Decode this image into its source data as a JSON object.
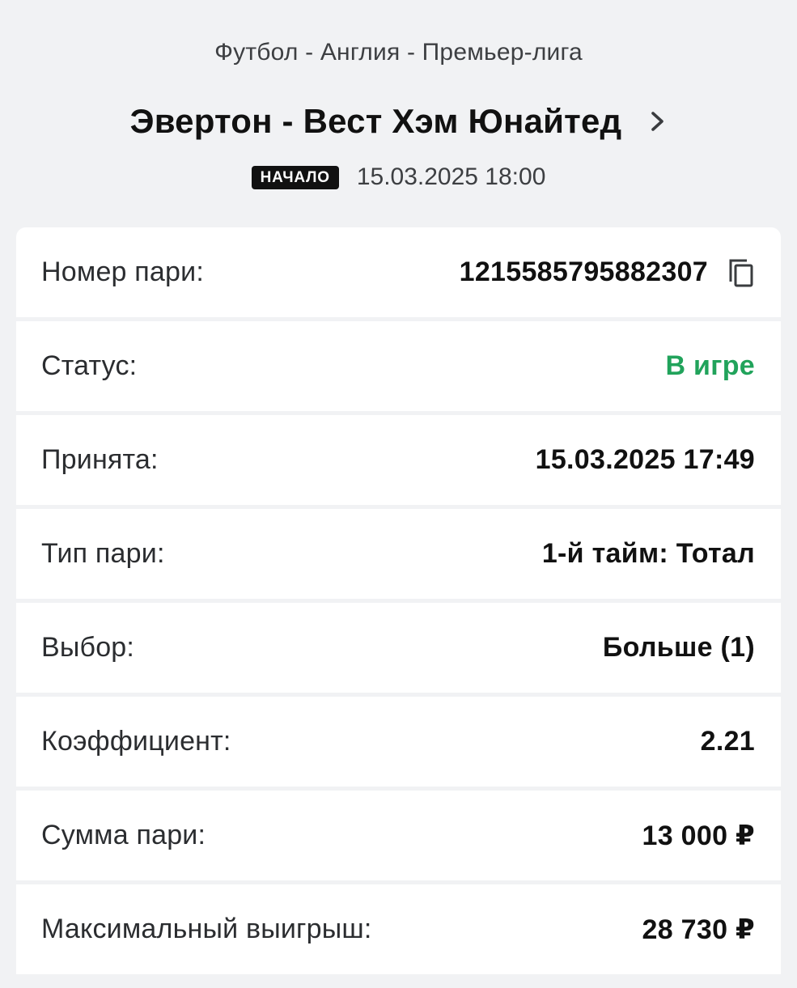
{
  "event": {
    "league": "Футбол - Англия - Премьер-лига",
    "match_title": "Эвертон - Вест Хэм Юнайтед",
    "start_badge": "НАЧАЛО",
    "start_datetime": "15.03.2025 18:00"
  },
  "details": [
    {
      "label": "Номер пари:",
      "value": "1215585795882307"
    },
    {
      "label": "Статус:",
      "value": "В игре"
    },
    {
      "label": "Принята:",
      "value": "15.03.2025 17:49"
    },
    {
      "label": "Тип пари:",
      "value": "1-й тайм: Тотал"
    },
    {
      "label": "Выбор:",
      "value": "Больше (1)"
    },
    {
      "label": "Коэффициент:",
      "value": "2.21"
    },
    {
      "label": "Сумма пари:",
      "value": "13 000 ₽"
    },
    {
      "label": "Максимальный выигрыш:",
      "value": "28 730 ₽"
    }
  ],
  "icons": {
    "chevron": "chevron-right-icon",
    "copy": "copy-icon"
  },
  "colors": {
    "background": "#f1f2f4",
    "status_active": "#21a35b",
    "badge_bg": "#111111"
  }
}
